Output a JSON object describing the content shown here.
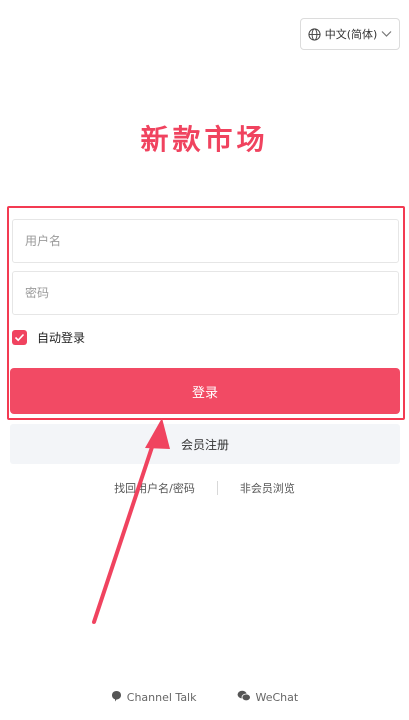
{
  "header": {
    "language_label": "中文(简体)",
    "globe_icon": "globe-icon",
    "chevron_icon": "chevron-down-icon"
  },
  "brand": {
    "title": "新款市场"
  },
  "form": {
    "username_placeholder": "用户名",
    "password_placeholder": "密码",
    "remember_label": "自动登录",
    "remember_checked": true,
    "login_label": "登录",
    "register_label": "会员注册"
  },
  "links": {
    "find_account": "找回用户名/密码",
    "guest_browse": "非会员浏览"
  },
  "footer": {
    "channel_talk": "Channel Talk",
    "wechat": "WeChat"
  },
  "colors": {
    "accent": "#f24a64",
    "title": "#f0435f",
    "highlight": "#f33a52",
    "register_bg": "#f3f5f8"
  }
}
